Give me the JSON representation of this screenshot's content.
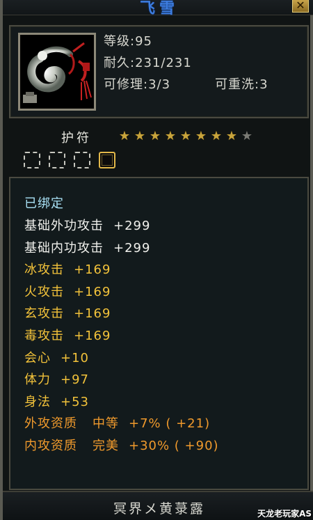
{
  "window": {
    "title": "飞雪",
    "close_label": "✕"
  },
  "item": {
    "icon": "jade-dragon-pendant-icon",
    "stats": {
      "level": "等级:95",
      "durability": "耐久:231/231",
      "repairable": "可修理:3/3",
      "rewashable": "可重洗:3"
    }
  },
  "amulet": {
    "label": "护符",
    "stars_filled": 8,
    "stars_total": 9,
    "gem_slots": [
      "empty",
      "empty",
      "empty",
      "gold"
    ]
  },
  "attributes": {
    "bound": "已绑定",
    "rows": [
      {
        "name": "基础外功攻击",
        "value": "+299",
        "color": "white"
      },
      {
        "name": "基础内功攻击",
        "value": "+299",
        "color": "white"
      },
      {
        "name": "冰攻击",
        "value": "+169",
        "color": "yellow"
      },
      {
        "name": "火攻击",
        "value": "+169",
        "color": "yellow"
      },
      {
        "name": "玄攻击",
        "value": "+169",
        "color": "yellow"
      },
      {
        "name": "毒攻击",
        "value": "+169",
        "color": "yellow"
      },
      {
        "name": "会心",
        "value": "+10",
        "color": "yellow"
      },
      {
        "name": "体力",
        "value": "+97",
        "color": "yellow"
      },
      {
        "name": "身法",
        "value": "+53",
        "color": "yellow"
      },
      {
        "name": "外攻资质",
        "grade": "中等",
        "value": "+7% ( +21)",
        "color": "orange"
      },
      {
        "name": "内攻资质",
        "grade": "完美",
        "value": "+30% ( +90)",
        "color": "orange"
      }
    ]
  },
  "footer": {
    "set_name": "冥界メ黄菉露",
    "watermark": "天龙老玩家AS"
  },
  "colors": {
    "title": "#3d7de0",
    "bound": "#a8e0f4",
    "yellow": "#f2c23a",
    "orange": "#f09a2c",
    "star": "#c8a43c"
  }
}
